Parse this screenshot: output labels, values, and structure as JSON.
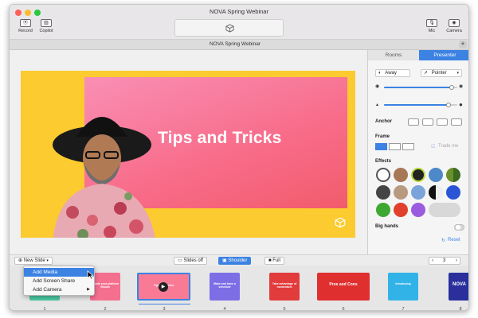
{
  "window": {
    "title": "NOVA Spring Webinar",
    "tab_title": "NOVA Spring Webinar",
    "tab_add": "+"
  },
  "toolbar": {
    "record_label": "Record",
    "copilot_label": "Copilot",
    "mic_label": "Mic",
    "camera_label": "Camera"
  },
  "slide": {
    "title": "Tips and Tricks"
  },
  "sidebar": {
    "tabs": [
      "Rooms",
      "Presenter"
    ],
    "active_tab": "Presenter",
    "status_label": "Away",
    "pointer_label": "Pointer",
    "anchor_label": "Anchor",
    "frame_label": "Frame",
    "trade_label": "Trade me",
    "effects_label": "Effects",
    "big_hands_label": "Big hands",
    "reset_label": "Reset",
    "opacity_level": 0.92,
    "size_level": 0.88
  },
  "bottombar": {
    "new_slide_label": "New Slide",
    "layouts": [
      "Slides off",
      "Shoulder",
      "Full"
    ],
    "active_layout": "Shoulder",
    "page_number": "3"
  },
  "menu": {
    "items": [
      "Add Media",
      "Add Screen Share",
      "Add Camera"
    ]
  },
  "slides": [
    {
      "num": "1",
      "text": ""
    },
    {
      "num": "2",
      "text": "Create your platform visuals"
    },
    {
      "num": "3",
      "text": "Tips and Tricks"
    },
    {
      "num": "4",
      "text": "Make and have a schedule"
    },
    {
      "num": "5",
      "text": "Take advantage of momentum"
    },
    {
      "num": "6",
      "text": "Pros and Cons"
    },
    {
      "num": "7",
      "text": "Introducing"
    },
    {
      "num": "8",
      "text": "NOVA"
    }
  ],
  "colors": {
    "accent": "#3b82e3",
    "slide_bg": "#fbcb2f",
    "slide_pink": "#f86b88"
  }
}
